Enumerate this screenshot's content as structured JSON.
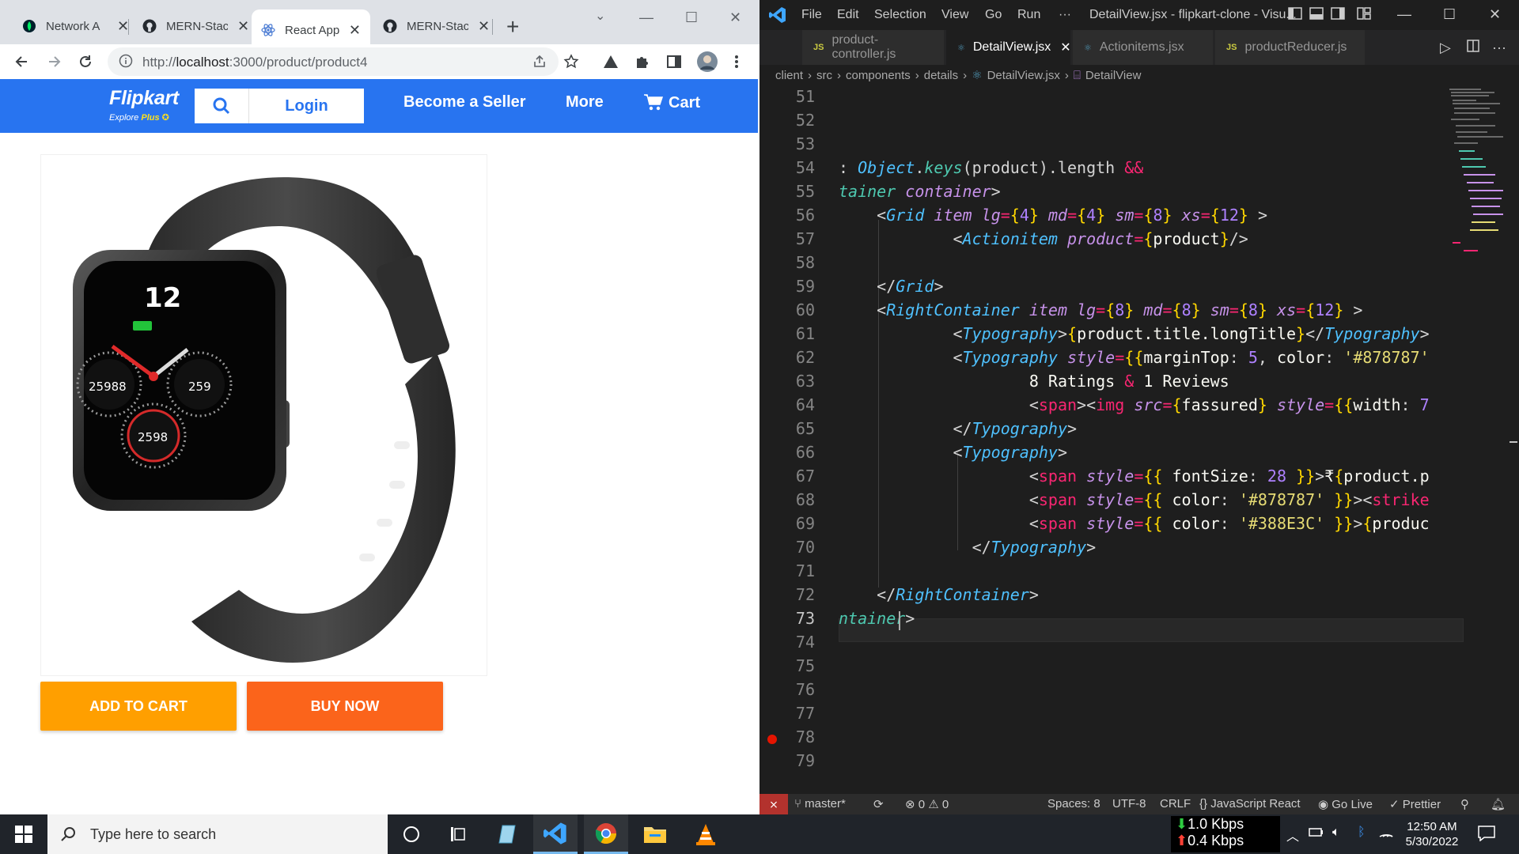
{
  "browser": {
    "tabs": [
      {
        "label": "Network A",
        "icon": "mongodb-leaf-icon"
      },
      {
        "label": "MERN-Stac",
        "icon": "github-icon"
      },
      {
        "label": "React App",
        "icon": "react-icon"
      },
      {
        "label": "MERN-Stac",
        "icon": "github-icon"
      }
    ],
    "active_tab": 2,
    "url_prefix": "http://",
    "url_host": "localhost",
    "url_path": ":3000/product/product4"
  },
  "flipkart": {
    "brand": "Flipkart",
    "tagline_prefix": "Explore ",
    "tagline_highlight": "Plus",
    "login_label": "Login",
    "nav_seller": "Become a Seller",
    "nav_more": "More",
    "cart_label": "Cart",
    "add_to_cart": "ADD TO CART",
    "buy_now": "BUY NOW",
    "colors": {
      "header": "#2874f0",
      "add_to_cart": "#ff9f00",
      "buy_now": "#fb641b"
    },
    "watch_display": {
      "hour": "12",
      "left_dial": "25988",
      "right_dial": "259",
      "bottom_dial": "2598"
    }
  },
  "vscode": {
    "menu": [
      "File",
      "Edit",
      "Selection",
      "View",
      "Go",
      "Run",
      "···"
    ],
    "window_title": "DetailView.jsx - flipkart-clone - Visu...",
    "tabs": [
      {
        "label": "product-controller.js",
        "type": "JS"
      },
      {
        "label": "DetailView.jsx",
        "type": "react"
      },
      {
        "label": "Actionitems.jsx",
        "type": "react"
      },
      {
        "label": "productReducer.js",
        "type": "JS"
      }
    ],
    "breadcrumb": [
      "client",
      "src",
      "components",
      "details",
      "DetailView.jsx",
      "DetailView"
    ],
    "line_numbers": [
      "51",
      "52",
      "53",
      "54",
      "55",
      "56",
      "57",
      "58",
      "59",
      "60",
      "61",
      "62",
      "63",
      "64",
      "65",
      "66",
      "67",
      "68",
      "69",
      "70",
      "71",
      "72",
      "73",
      "74",
      "75",
      "76",
      "77",
      "78",
      "79"
    ],
    "current_line": "73",
    "status": {
      "branch": "master*",
      "errors": "0",
      "warnings": "0",
      "spaces": "Spaces: 8",
      "encoding": "UTF-8",
      "eol": "CRLF",
      "language": "JavaScript React",
      "golive": "Go Live",
      "prettier": "Prettier"
    }
  },
  "taskbar": {
    "search_placeholder": "Type here to search",
    "net_down": "1.0 Kbps",
    "net_up": "0.4 Kbps",
    "time": "12:50 AM",
    "date": "5/30/2022"
  }
}
